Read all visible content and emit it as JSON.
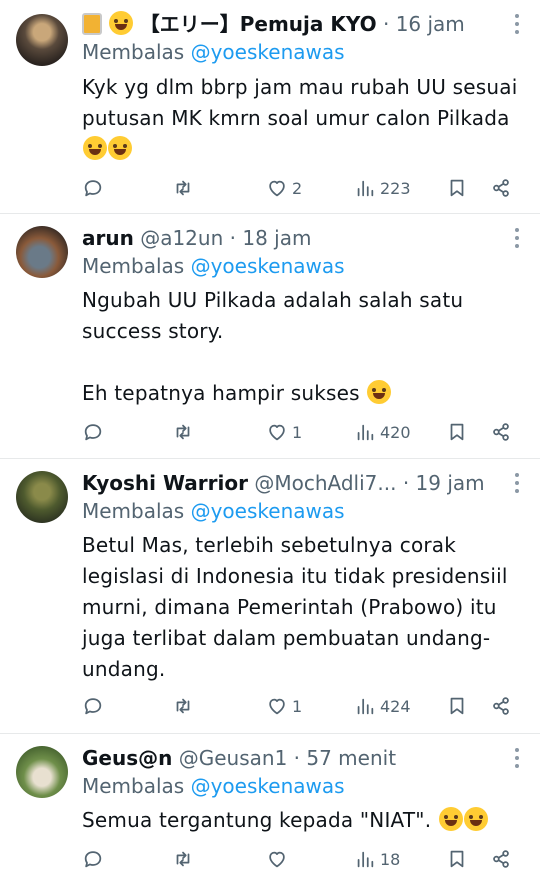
{
  "reply_prefix": "Membalas",
  "tweets": [
    {
      "name": "【エリー】Pemuja KYO",
      "name_emojis": [
        "beer-mug-emoji",
        "smile-emoji"
      ],
      "handle": "",
      "dot": "·",
      "time": "16 jam",
      "reply_to": "@yoeskenawas",
      "text": "Kyk yg dlm bbrp jam mau rubah UU sesuai putusan MK kmrn soal umur calon Pilkada",
      "trailing_emojis": [
        "grinning-sweat-emoji",
        "rofl-emoji"
      ],
      "likes": "2",
      "views": "223"
    },
    {
      "name": "arun",
      "handle": "@a12un",
      "dot": "·",
      "time": "18 jam",
      "reply_to": "@yoeskenawas",
      "text": "Ngubah UU Pilkada adalah salah satu success story.\n\nEh tepatnya hampir sukses",
      "trailing_emojis": [
        "grinning-sweat-emoji"
      ],
      "likes": "1",
      "views": "420"
    },
    {
      "name": "Kyoshi Warrior",
      "handle": "@MochAdli7...",
      "dot": "·",
      "time": "19 jam",
      "reply_to": "@yoeskenawas",
      "text": "Betul Mas, terlebih sebetulnya corak legislasi di Indonesia itu tidak presidensiil murni, dimana Pemerintah (Prabowo) itu juga terlibat dalam pembuatan undang-undang.",
      "trailing_emojis": [],
      "likes": "1",
      "views": "424"
    },
    {
      "name": "Geus@n",
      "handle": "@Geusan1",
      "dot": "·",
      "time": "57 menit",
      "reply_to": "@yoeskenawas",
      "text": "Semua tergantung kepada \"NIAT\".",
      "trailing_emojis": [
        "yawning-face-emoji",
        "beaming-grin-emoji"
      ],
      "likes": "",
      "views": "18"
    }
  ],
  "colors": {
    "accent": "#1d9bf0",
    "muted": "#536471",
    "text": "#0f1419",
    "divider": "#e7e9ea"
  }
}
